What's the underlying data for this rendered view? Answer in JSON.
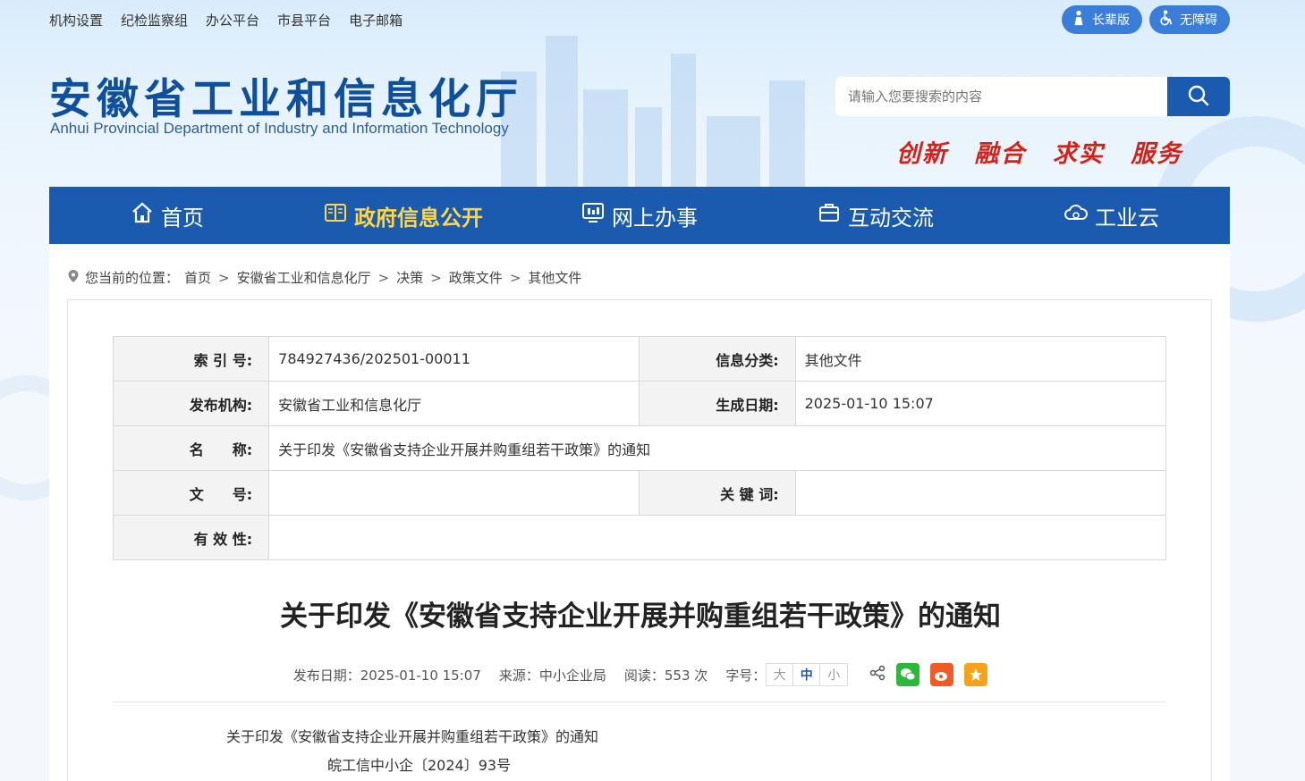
{
  "top_links": [
    "机构设置",
    "纪检监察组",
    "办公平台",
    "市县平台",
    "电子邮箱"
  ],
  "top_buttons": {
    "elder": "长辈版",
    "accessible": "无障碍"
  },
  "site": {
    "title": "安徽省工业和信息化厅",
    "subtitle": "Anhui Provincial Department of Industry and Information Technology"
  },
  "search": {
    "placeholder": "请输入您要搜索的内容"
  },
  "slogan": [
    "创新",
    "融合",
    "求实",
    "服务"
  ],
  "nav": [
    {
      "label": "首页",
      "icon": "home-icon"
    },
    {
      "label": "政府信息公开",
      "icon": "book-icon",
      "active": true
    },
    {
      "label": "网上办事",
      "icon": "monitor-icon"
    },
    {
      "label": "互动交流",
      "icon": "briefcase-icon"
    },
    {
      "label": "工业云",
      "icon": "cloud-gear-icon"
    }
  ],
  "breadcrumb": {
    "prefix": "您当前的位置：",
    "items": [
      "首页",
      "安徽省工业和信息化厅",
      "决策",
      "政策文件",
      "其他文件"
    ]
  },
  "meta": {
    "index_label": "索 引 号:",
    "index_value": "784927436/202501-00011",
    "category_label": "信息分类:",
    "category_value": "其他文件",
    "publisher_label": "发布机构:",
    "publisher_value": "安徽省工业和信息化厅",
    "date_label": "生成日期:",
    "date_value": "2025-01-10 15:07",
    "name_label": "名　　称:",
    "name_value": "关于印发《安徽省支持企业开展并购重组若干政策》的通知",
    "docno_label": "文　　号:",
    "docno_value": "",
    "keywords_label": "关 键 词:",
    "keywords_value": "",
    "validity_label": "有 效 性:",
    "validity_value": ""
  },
  "article": {
    "title": "关于印发《安徽省支持企业开展并购重组若干政策》的通知",
    "publish_date": "发布日期：2025-01-10 15:07",
    "source": "来源：中小企业局",
    "reads": "阅读：553 次",
    "font_label": "字号：",
    "font_sizes": [
      "大",
      "中",
      "小"
    ],
    "body_line1": "关于印发《安徽省支持企业开展并购重组若干政策》的通知",
    "body_line2": "皖工信中小企〔2024〕93号"
  }
}
